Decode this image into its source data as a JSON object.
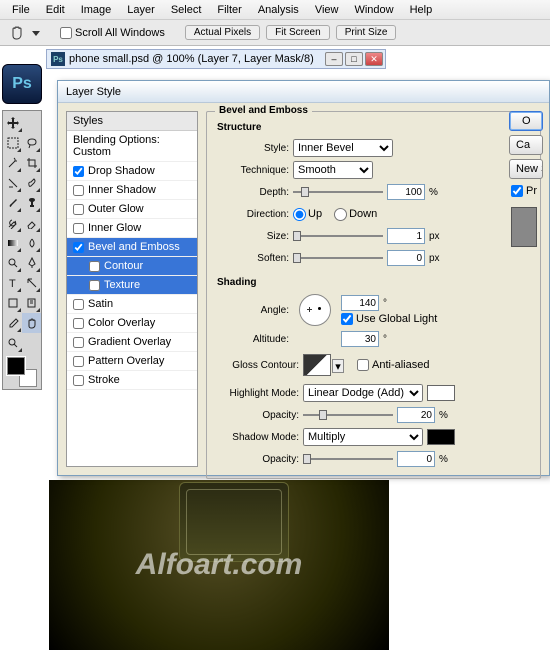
{
  "menu": [
    "File",
    "Edit",
    "Image",
    "Layer",
    "Select",
    "Filter",
    "Analysis",
    "View",
    "Window",
    "Help"
  ],
  "options": {
    "scroll_all": "Scroll All Windows",
    "btn1": "Actual Pixels",
    "btn2": "Fit Screen",
    "btn3": "Print Size"
  },
  "doc": {
    "title": "phone small.psd @ 100% (Layer 7, Layer Mask/8)"
  },
  "app_icon": "Ps",
  "dialog": {
    "title": "Layer Style",
    "styles_header": "Styles",
    "blending": "Blending Options: Custom",
    "items": [
      {
        "label": "Drop Shadow",
        "checked": true
      },
      {
        "label": "Inner Shadow",
        "checked": false
      },
      {
        "label": "Outer Glow",
        "checked": false
      },
      {
        "label": "Inner Glow",
        "checked": false
      },
      {
        "label": "Bevel and Emboss",
        "checked": true,
        "selected": true
      },
      {
        "label": "Contour",
        "checked": false,
        "sub": true,
        "selected": true
      },
      {
        "label": "Texture",
        "checked": false,
        "sub": true,
        "selected": true
      },
      {
        "label": "Satin",
        "checked": false
      },
      {
        "label": "Color Overlay",
        "checked": false
      },
      {
        "label": "Gradient Overlay",
        "checked": false
      },
      {
        "label": "Pattern Overlay",
        "checked": false
      },
      {
        "label": "Stroke",
        "checked": false
      }
    ],
    "panel_title": "Bevel and Emboss",
    "structure": {
      "heading": "Structure",
      "style_lbl": "Style:",
      "style_val": "Inner Bevel",
      "tech_lbl": "Technique:",
      "tech_val": "Smooth",
      "depth_lbl": "Depth:",
      "depth_val": "100",
      "depth_unit": "%",
      "dir_lbl": "Direction:",
      "up": "Up",
      "down": "Down",
      "size_lbl": "Size:",
      "size_val": "1",
      "size_unit": "px",
      "soften_lbl": "Soften:",
      "soften_val": "0",
      "soften_unit": "px"
    },
    "shading": {
      "heading": "Shading",
      "angle_lbl": "Angle:",
      "angle_val": "140",
      "deg": "°",
      "global": "Use Global Light",
      "alt_lbl": "Altitude:",
      "alt_val": "30",
      "gloss_lbl": "Gloss Contour:",
      "aa": "Anti-aliased",
      "hmode_lbl": "Highlight Mode:",
      "hmode_val": "Linear Dodge (Add)",
      "hopacity_lbl": "Opacity:",
      "hopacity_val": "20",
      "pct": "%",
      "smode_lbl": "Shadow Mode:",
      "smode_val": "Multiply",
      "sopacity_lbl": "Opacity:",
      "sopacity_val": "0",
      "hcolor": "#ffffff",
      "scolor": "#000000"
    },
    "buttons": {
      "ok": "O",
      "cancel": "Ca",
      "newstyle": "New S",
      "preview": "Pr"
    }
  },
  "watermark": "Alfoart.com"
}
